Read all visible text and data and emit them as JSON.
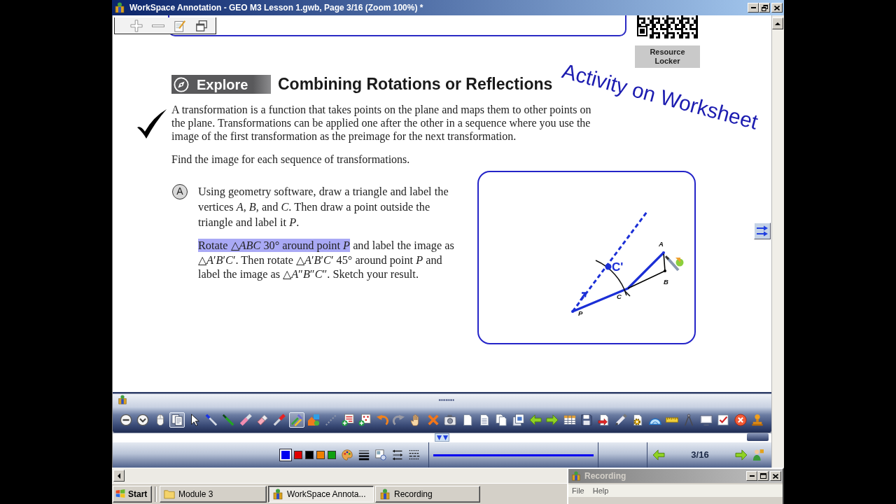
{
  "window": {
    "title": "WorkSpace Annotation - GEO M3 Lesson 1.gwb, Page 3/16 (Zoom 100%) *"
  },
  "document": {
    "resource_button": "Resource Locker",
    "section_tag": "Explore",
    "heading": "Combining Rotations or Reflections",
    "intro": "A transformation is a function that takes points on the plane and maps them to other points on the plane. Transformations can be applied one after the other in a sequence where you use the image of the first transformation as the preimage for the next transformation.",
    "instruction": "Find the image for each sequence of transformations.",
    "parts": [
      {
        "label": "A",
        "paragraphs": [
          {
            "segments": [
              {
                "text": "Using geometry software, draw a triangle and label the vertices *A*, *B*, and *C*. Then draw a point outside the triangle and label it *P*.",
                "highlighted": false
              }
            ]
          },
          {
            "segments": [
              {
                "text": "Rotate △*ABC* 30° around point *P*",
                "highlighted": true
              },
              {
                "text": "and label the image as △*A*′*B*′*C*′. Then rotate △*A*′*B*′*C*′ 45° around point *P* and label the image as △*A*″*B*″*C*″. Sketch your result.",
                "highlighted": false
              }
            ]
          }
        ],
        "sketch": {
          "labels": [
            {
              "text": "A",
              "kind": "vertex"
            },
            {
              "text": "C'",
              "kind": "handwritten"
            },
            {
              "text": "B",
              "kind": "vertex"
            },
            {
              "text": "C",
              "kind": "vertex"
            },
            {
              "text": "P",
              "kind": "vertex"
            }
          ]
        }
      }
    ]
  },
  "annotations": [
    {
      "kind": "checkmark"
    },
    {
      "kind": "handwriting",
      "text": "Activity on Worksheet"
    }
  ],
  "toolbar": {
    "tools": [
      {
        "kind": "zoomout",
        "selected": false
      },
      {
        "kind": "collapse",
        "selected": false
      },
      {
        "kind": "mouse",
        "selected": false
      },
      {
        "kind": "pages",
        "selected": true
      },
      {
        "kind": "pointer",
        "selected": false
      },
      {
        "kind": "wand",
        "selected": false
      },
      {
        "kind": "pen",
        "selected": false
      },
      {
        "kind": "highlighter",
        "selected": false
      },
      {
        "kind": "eraser",
        "selected": false
      },
      {
        "kind": "marker",
        "selected": false
      },
      {
        "kind": "pens",
        "selected": true
      },
      {
        "kind": "shapes",
        "selected": false
      },
      {
        "kind": "dotted",
        "selected": false
      },
      {
        "kind": "textadd",
        "selected": false
      },
      {
        "kind": "symboladd",
        "selected": false
      },
      {
        "kind": "undo",
        "selected": false
      },
      {
        "kind": "redo",
        "selected": false
      },
      {
        "kind": "hand",
        "selected": false
      },
      {
        "kind": "delete",
        "selected": false
      },
      {
        "kind": "camera",
        "selected": false
      },
      {
        "kind": "page",
        "selected": false
      },
      {
        "kind": "linedpage",
        "selected": false
      },
      {
        "kind": "copy",
        "selected": false
      },
      {
        "kind": "stack",
        "selected": false
      },
      {
        "kind": "back",
        "selected": false
      },
      {
        "kind": "forward",
        "selected": false
      },
      {
        "kind": "table",
        "selected": false
      },
      {
        "kind": "save",
        "selected": false
      },
      {
        "kind": "export",
        "selected": false
      },
      {
        "kind": "pencil",
        "selected": false
      },
      {
        "kind": "gear",
        "selected": false
      },
      {
        "kind": "protractor",
        "selected": false
      },
      {
        "kind": "ruler",
        "selected": false
      },
      {
        "kind": "compass",
        "selected": false
      },
      {
        "kind": "screen",
        "selected": false
      },
      {
        "kind": "checklist",
        "selected": false
      },
      {
        "kind": "close",
        "selected": false
      },
      {
        "kind": "stamp",
        "selected": false
      }
    ]
  },
  "style_bar": {
    "colors": [
      {
        "color": "#0000f0",
        "selected": true
      },
      {
        "color": "#e00000",
        "selected": false
      },
      {
        "color": "#000000",
        "selected": false
      },
      {
        "color": "#f08000",
        "selected": false
      },
      {
        "color": "#10a010",
        "selected": false
      }
    ],
    "page": "3/16"
  },
  "taskbar": {
    "start": "Start",
    "tasks": [
      {
        "label": "Module 3",
        "kind": "folder",
        "selected": false
      },
      {
        "label": "WorkSpace Annota...",
        "kind": "app",
        "selected": true
      },
      {
        "label": "Recording",
        "kind": "app",
        "selected": false
      }
    ]
  },
  "recording_window": {
    "title": "Recording",
    "active": false,
    "menus": [
      "File",
      "Help"
    ]
  }
}
